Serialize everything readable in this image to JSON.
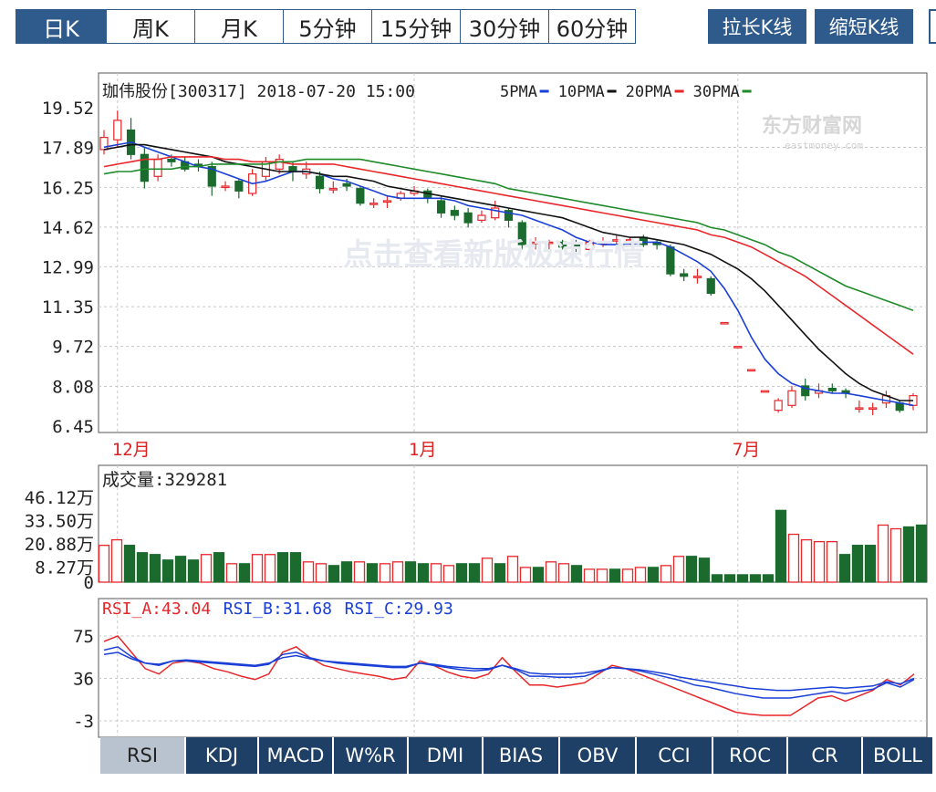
{
  "top_tabs": [
    {
      "label": "日K",
      "active": true
    },
    {
      "label": "周K",
      "active": false
    },
    {
      "label": "月K",
      "active": false
    },
    {
      "label": "5分钟",
      "active": false
    },
    {
      "label": "15分钟",
      "active": false
    },
    {
      "label": "30分钟",
      "active": false
    },
    {
      "label": "60分钟",
      "active": false
    }
  ],
  "buttons": {
    "stretch_label": "拉长K线",
    "shrink_label": "缩短K线"
  },
  "header": {
    "title": "珈伟股份[300317] 2018-07-20 15:00",
    "legend": [
      {
        "label": "5PMA",
        "color": "#1a3fd6"
      },
      {
        "label": "10PMA",
        "color": "#111111"
      },
      {
        "label": "20PMA",
        "color": "#e8272b"
      },
      {
        "label": "30PMA",
        "color": "#1f8a2a"
      }
    ]
  },
  "watermark": {
    "logo_text": "东方财富网",
    "logo_sub": "eastmoney.com",
    "overlay": "点击查看新版极速行情"
  },
  "volume_header": "成交量:329281",
  "rsi_header": [
    {
      "label": "RSI_A:43.04",
      "color": "#e8272b"
    },
    {
      "label": "RSI_B:31.68",
      "color": "#1a3fd6"
    },
    {
      "label": "RSI_C:29.93",
      "color": "#1a3fd6"
    }
  ],
  "bottom_tabs": [
    {
      "label": "RSI",
      "active": true
    },
    {
      "label": "KDJ",
      "active": false
    },
    {
      "label": "MACD",
      "active": false
    },
    {
      "label": "W%R",
      "active": false
    },
    {
      "label": "DMI",
      "active": false
    },
    {
      "label": "BIAS",
      "active": false
    },
    {
      "label": "OBV",
      "active": false
    },
    {
      "label": "CCI",
      "active": false
    },
    {
      "label": "ROC",
      "active": false
    },
    {
      "label": "CR",
      "active": false
    },
    {
      "label": "BOLL",
      "active": false
    }
  ],
  "chart_data": [
    {
      "type": "candlestick",
      "title": "珈伟股份[300317] 2018-07-20 15:00",
      "y_ticks": [
        "19.52",
        "17.89",
        "16.25",
        "14.62",
        "12.99",
        "11.35",
        "9.72",
        "8.08",
        "6.45"
      ],
      "ylim": [
        6.45,
        19.52
      ],
      "x_ticks": [
        {
          "label": "12月",
          "at_candle": 1
        },
        {
          "label": "1月",
          "at_candle": 23
        },
        {
          "label": "7月",
          "at_candle": 47
        }
      ],
      "candles": [
        {
          "o": 17.8,
          "c": 18.3,
          "h": 18.6,
          "l": 17.6
        },
        {
          "o": 18.2,
          "c": 19.0,
          "h": 19.4,
          "l": 17.9
        },
        {
          "o": 18.6,
          "c": 17.6,
          "h": 19.1,
          "l": 17.4
        },
        {
          "o": 17.6,
          "c": 16.5,
          "h": 17.9,
          "l": 16.2
        },
        {
          "o": 16.7,
          "c": 17.4,
          "h": 17.6,
          "l": 16.5
        },
        {
          "o": 17.4,
          "c": 17.3,
          "h": 17.6,
          "l": 17.1
        },
        {
          "o": 17.3,
          "c": 17.0,
          "h": 17.5,
          "l": 16.9
        },
        {
          "o": 17.2,
          "c": 17.1,
          "h": 17.4,
          "l": 16.9
        },
        {
          "o": 17.1,
          "c": 16.3,
          "h": 17.3,
          "l": 15.9
        },
        {
          "o": 16.3,
          "c": 16.3,
          "h": 16.5,
          "l": 16.1
        },
        {
          "o": 16.5,
          "c": 16.1,
          "h": 16.6,
          "l": 15.8
        },
        {
          "o": 16.0,
          "c": 16.8,
          "h": 17.0,
          "l": 15.9
        },
        {
          "o": 16.7,
          "c": 17.3,
          "h": 17.5,
          "l": 16.5
        },
        {
          "o": 17.0,
          "c": 17.4,
          "h": 17.6,
          "l": 16.8
        },
        {
          "o": 17.1,
          "c": 16.9,
          "h": 17.3,
          "l": 16.5
        },
        {
          "o": 16.8,
          "c": 17.0,
          "h": 17.3,
          "l": 16.6
        },
        {
          "o": 16.7,
          "c": 16.2,
          "h": 16.9,
          "l": 16.0
        },
        {
          "o": 16.2,
          "c": 16.2,
          "h": 16.5,
          "l": 16.0
        },
        {
          "o": 16.4,
          "c": 16.3,
          "h": 16.6,
          "l": 16.1
        },
        {
          "o": 16.2,
          "c": 15.6,
          "h": 16.3,
          "l": 15.5
        },
        {
          "o": 15.6,
          "c": 15.6,
          "h": 15.8,
          "l": 15.4
        },
        {
          "o": 15.7,
          "c": 15.7,
          "h": 15.9,
          "l": 15.4
        },
        {
          "o": 15.8,
          "c": 16.0,
          "h": 16.1,
          "l": 15.7
        },
        {
          "o": 16.0,
          "c": 16.1,
          "h": 16.3,
          "l": 15.9
        },
        {
          "o": 16.1,
          "c": 15.8,
          "h": 16.2,
          "l": 15.6
        },
        {
          "o": 15.7,
          "c": 15.2,
          "h": 15.9,
          "l": 15.0
        },
        {
          "o": 15.3,
          "c": 15.1,
          "h": 15.5,
          "l": 14.9
        },
        {
          "o": 15.2,
          "c": 14.8,
          "h": 15.4,
          "l": 14.6
        },
        {
          "o": 14.9,
          "c": 15.1,
          "h": 15.3,
          "l": 14.8
        },
        {
          "o": 15.0,
          "c": 15.4,
          "h": 15.7,
          "l": 14.9
        },
        {
          "o": 15.3,
          "c": 14.9,
          "h": 15.4,
          "l": 14.6
        },
        {
          "o": 14.8,
          "c": 13.9,
          "h": 14.9,
          "l": 13.7
        },
        {
          "o": 14.0,
          "c": 14.0,
          "h": 14.2,
          "l": 13.7
        },
        {
          "o": 14.0,
          "c": 14.0,
          "h": 14.1,
          "l": 13.6
        },
        {
          "o": 14.0,
          "c": 13.8,
          "h": 14.1,
          "l": 13.7
        },
        {
          "o": 13.9,
          "c": 13.8,
          "h": 14.1,
          "l": 13.6
        },
        {
          "o": 13.7,
          "c": 14.0,
          "h": 14.1,
          "l": 13.5
        },
        {
          "o": 14.0,
          "c": 14.0,
          "h": 14.2,
          "l": 13.8
        },
        {
          "o": 14.1,
          "c": 14.1,
          "h": 14.3,
          "l": 13.9
        },
        {
          "o": 14.1,
          "c": 14.1,
          "h": 14.2,
          "l": 13.9
        },
        {
          "o": 14.2,
          "c": 13.9,
          "h": 14.3,
          "l": 13.8
        },
        {
          "o": 14.0,
          "c": 13.9,
          "h": 14.1,
          "l": 13.7
        },
        {
          "o": 13.8,
          "c": 12.7,
          "h": 13.9,
          "l": 12.6
        },
        {
          "o": 12.7,
          "c": 12.6,
          "h": 12.9,
          "l": 12.4
        },
        {
          "o": 12.6,
          "c": 12.6,
          "h": 12.9,
          "l": 12.3
        },
        {
          "o": 12.5,
          "c": 11.9,
          "h": 12.6,
          "l": 11.8
        },
        {
          "o": 10.7,
          "c": 10.7,
          "h": 10.7,
          "l": 10.7
        },
        {
          "o": 9.72,
          "c": 9.72,
          "h": 9.72,
          "l": 9.72
        },
        {
          "o": 8.77,
          "c": 8.77,
          "h": 8.77,
          "l": 8.77
        },
        {
          "o": 7.9,
          "c": 7.9,
          "h": 7.9,
          "l": 7.9
        },
        {
          "o": 7.1,
          "c": 7.5,
          "h": 7.6,
          "l": 7.0
        },
        {
          "o": 7.3,
          "c": 7.9,
          "h": 8.1,
          "l": 7.2
        },
        {
          "o": 8.1,
          "c": 7.7,
          "h": 8.4,
          "l": 7.5
        },
        {
          "o": 7.8,
          "c": 7.9,
          "h": 8.2,
          "l": 7.6
        },
        {
          "o": 8.0,
          "c": 7.9,
          "h": 8.2,
          "l": 7.8
        },
        {
          "o": 7.9,
          "c": 7.8,
          "h": 8.0,
          "l": 7.6
        },
        {
          "o": 7.2,
          "c": 7.2,
          "h": 7.5,
          "l": 7.0
        },
        {
          "o": 7.2,
          "c": 7.2,
          "h": 7.4,
          "l": 6.9
        },
        {
          "o": 7.4,
          "c": 7.7,
          "h": 7.9,
          "l": 7.2
        },
        {
          "o": 7.4,
          "c": 7.1,
          "h": 7.5,
          "l": 7.0
        },
        {
          "o": 7.3,
          "c": 7.7,
          "h": 7.8,
          "l": 7.1
        }
      ],
      "series": [
        {
          "name": "5PMA",
          "color": "#1a3fd6",
          "values": [
            17.9,
            18.0,
            18.1,
            17.9,
            17.7,
            17.5,
            17.3,
            17.1,
            17.0,
            16.8,
            16.6,
            16.4,
            16.5,
            16.7,
            16.9,
            16.9,
            16.8,
            16.6,
            16.5,
            16.3,
            16.1,
            15.9,
            15.8,
            15.8,
            15.8,
            15.8,
            15.7,
            15.5,
            15.4,
            15.3,
            15.2,
            15.1,
            14.9,
            14.7,
            14.5,
            14.2,
            14.0,
            13.9,
            13.9,
            13.9,
            14.0,
            14.0,
            13.8,
            13.5,
            13.2,
            12.8,
            12.1,
            11.2,
            10.1,
            9.2,
            8.6,
            8.2,
            8.0,
            7.9,
            7.8,
            7.8,
            7.7,
            7.6,
            7.5,
            7.4,
            7.3
          ]
        },
        {
          "name": "10PMA",
          "color": "#111111",
          "values": [
            17.8,
            17.9,
            18.0,
            18.0,
            17.9,
            17.8,
            17.7,
            17.6,
            17.5,
            17.3,
            17.2,
            17.1,
            17.0,
            16.9,
            16.9,
            16.9,
            16.8,
            16.7,
            16.7,
            16.6,
            16.5,
            16.3,
            16.2,
            16.1,
            16.0,
            15.9,
            15.8,
            15.7,
            15.6,
            15.5,
            15.4,
            15.3,
            15.2,
            15.1,
            15.0,
            14.8,
            14.6,
            14.4,
            14.3,
            14.2,
            14.2,
            14.1,
            14.0,
            13.9,
            13.7,
            13.5,
            13.2,
            12.9,
            12.5,
            12.0,
            11.4,
            10.8,
            10.2,
            9.6,
            9.1,
            8.6,
            8.2,
            7.9,
            7.7,
            7.5,
            7.5
          ]
        },
        {
          "name": "20PMA",
          "color": "#e8272b",
          "values": [
            17.1,
            17.2,
            17.3,
            17.4,
            17.4,
            17.5,
            17.5,
            17.5,
            17.5,
            17.4,
            17.4,
            17.3,
            17.3,
            17.3,
            17.2,
            17.2,
            17.2,
            17.2,
            17.1,
            17.0,
            16.9,
            16.8,
            16.7,
            16.6,
            16.5,
            16.4,
            16.3,
            16.2,
            16.1,
            16.0,
            15.9,
            15.8,
            15.7,
            15.6,
            15.5,
            15.4,
            15.3,
            15.2,
            15.1,
            15.0,
            14.9,
            14.8,
            14.7,
            14.6,
            14.5,
            14.3,
            14.2,
            14.0,
            13.8,
            13.5,
            13.2,
            12.9,
            12.6,
            12.2,
            11.8,
            11.4,
            11.0,
            10.6,
            10.2,
            9.8,
            9.4
          ]
        },
        {
          "name": "30PMA",
          "color": "#1f8a2a",
          "values": [
            16.8,
            16.9,
            16.9,
            17.0,
            17.0,
            17.0,
            17.1,
            17.1,
            17.2,
            17.2,
            17.2,
            17.2,
            17.2,
            17.3,
            17.3,
            17.4,
            17.4,
            17.4,
            17.4,
            17.4,
            17.3,
            17.2,
            17.1,
            17.0,
            16.9,
            16.8,
            16.7,
            16.6,
            16.5,
            16.4,
            16.2,
            16.1,
            16.0,
            15.9,
            15.8,
            15.7,
            15.6,
            15.5,
            15.4,
            15.3,
            15.2,
            15.1,
            15.0,
            14.9,
            14.8,
            14.6,
            14.5,
            14.3,
            14.1,
            13.9,
            13.6,
            13.4,
            13.1,
            12.8,
            12.5,
            12.2,
            12.0,
            11.8,
            11.6,
            11.4,
            11.2
          ]
        }
      ]
    },
    {
      "type": "bar",
      "title": "成交量:329281",
      "y_ticks": [
        "46.12万",
        "33.50万",
        "20.88万",
        "8.27万",
        "0"
      ],
      "ylim": [
        0,
        46.12
      ],
      "unit": "万",
      "values": [
        20,
        23,
        20,
        16,
        15,
        12,
        14,
        12,
        15,
        16,
        10,
        10,
        15,
        15,
        16,
        16,
        11,
        10,
        9,
        11,
        11,
        10,
        10,
        11,
        11,
        10,
        10,
        9,
        10,
        10,
        13,
        10,
        14,
        8,
        8,
        11,
        10,
        9,
        7,
        7,
        7,
        7,
        8,
        8,
        9,
        14,
        14,
        13,
        4,
        4,
        4,
        4,
        4,
        39,
        26,
        23,
        22,
        22,
        15,
        20,
        20,
        31,
        29,
        30,
        31
      ],
      "up": [
        1,
        1,
        0,
        0,
        0,
        0,
        0,
        0,
        1,
        0,
        1,
        0,
        1,
        1,
        0,
        0,
        1,
        1,
        0,
        0,
        1,
        0,
        1,
        1,
        0,
        0,
        1,
        1,
        0,
        0,
        1,
        0,
        1,
        1,
        0,
        1,
        1,
        0,
        1,
        1,
        0,
        1,
        1,
        0,
        1,
        1,
        0,
        0,
        0,
        0,
        0,
        0,
        0,
        0,
        1,
        1,
        1,
        1,
        0,
        0,
        0,
        1,
        1,
        0,
        0
      ]
    },
    {
      "type": "line",
      "title": "RSI",
      "y_ticks": [
        "75",
        "36",
        "-3"
      ],
      "ylim": [
        -3,
        75
      ],
      "series": [
        {
          "name": "RSI_A",
          "color": "#e8272b",
          "values": [
            70,
            75,
            60,
            45,
            40,
            50,
            52,
            50,
            45,
            42,
            38,
            35,
            40,
            60,
            65,
            55,
            48,
            45,
            42,
            40,
            38,
            35,
            37,
            52,
            48,
            42,
            38,
            36,
            40,
            55,
            42,
            30,
            30,
            28,
            30,
            32,
            40,
            48,
            45,
            40,
            35,
            30,
            25,
            20,
            15,
            10,
            5,
            3,
            2,
            2,
            2,
            10,
            18,
            20,
            15,
            20,
            25,
            35,
            30,
            40
          ]
        },
        {
          "name": "RSI_B",
          "color": "#1a3fd6",
          "values": [
            62,
            65,
            56,
            50,
            48,
            52,
            52,
            51,
            50,
            49,
            48,
            47,
            49,
            58,
            60,
            55,
            52,
            50,
            49,
            48,
            47,
            46,
            46,
            50,
            48,
            46,
            44,
            43,
            44,
            48,
            44,
            38,
            38,
            37,
            37,
            38,
            42,
            46,
            45,
            43,
            40,
            37,
            34,
            30,
            28,
            25,
            22,
            20,
            18,
            18,
            18,
            20,
            22,
            24,
            22,
            24,
            26,
            32,
            28,
            35
          ]
        },
        {
          "name": "RSI_C",
          "color": "#1a3fd6",
          "values": [
            58,
            60,
            54,
            50,
            49,
            52,
            53,
            52,
            51,
            50,
            49,
            48,
            50,
            55,
            57,
            54,
            52,
            51,
            50,
            49,
            48,
            47,
            47,
            50,
            49,
            47,
            46,
            45,
            45,
            48,
            45,
            41,
            40,
            40,
            40,
            41,
            43,
            46,
            45,
            44,
            42,
            40,
            37,
            35,
            33,
            31,
            29,
            27,
            26,
            25,
            25,
            26,
            27,
            28,
            27,
            28,
            29,
            33,
            31,
            36
          ]
        }
      ]
    }
  ]
}
